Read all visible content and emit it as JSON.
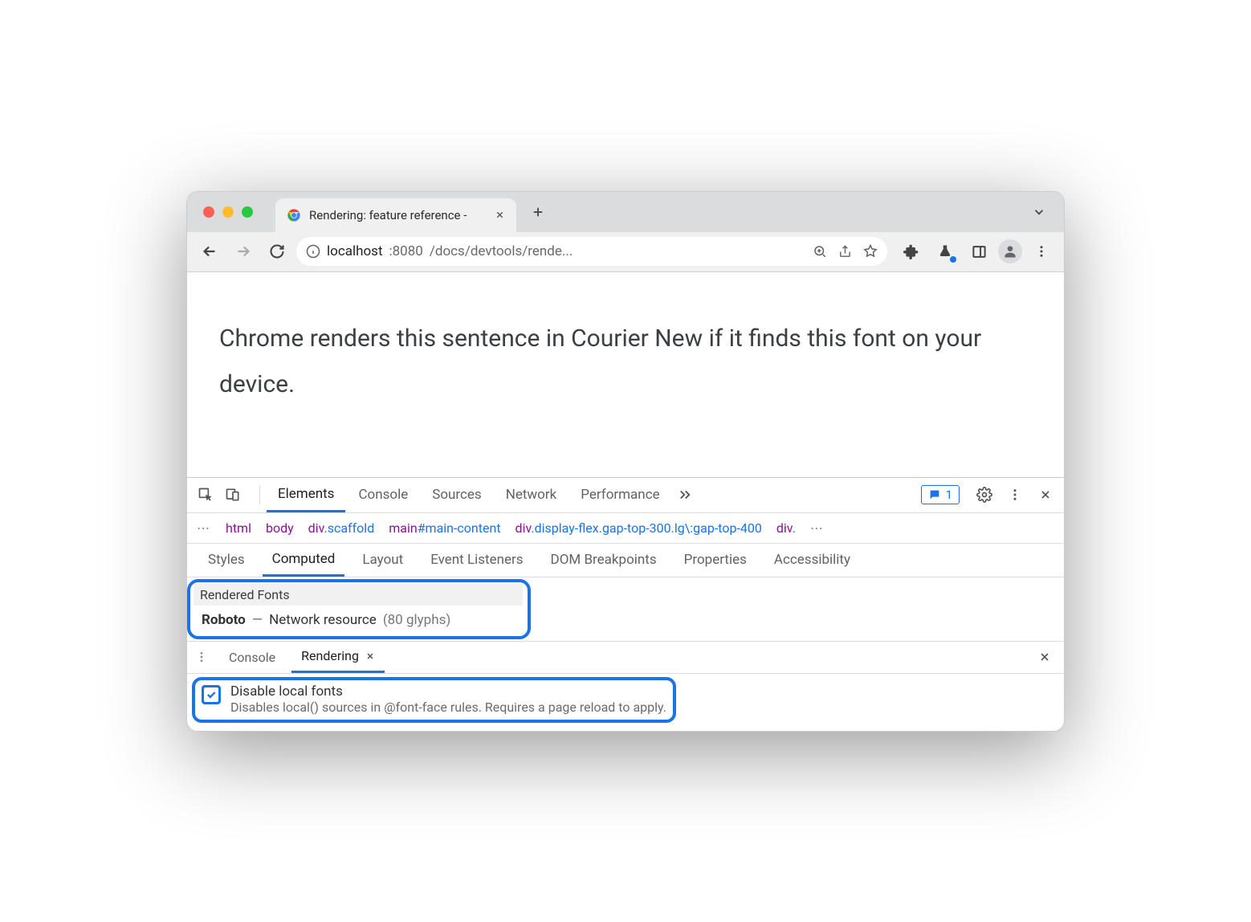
{
  "window": {
    "tab_title": "Rendering: feature reference -"
  },
  "omnibox": {
    "host": "localhost",
    "port": ":8080",
    "path": "/docs/devtools/rende..."
  },
  "page": {
    "sentence": "Chrome renders this sentence in Courier New if it finds this font on your device."
  },
  "devtools": {
    "tabs": [
      "Elements",
      "Console",
      "Sources",
      "Network",
      "Performance"
    ],
    "active_tab": "Elements",
    "issues_count": "1",
    "breadcrumb": [
      {
        "tag": "html"
      },
      {
        "tag": "body"
      },
      {
        "tag": "div",
        "cls": ".scaffold"
      },
      {
        "tag": "main",
        "id": "#main-content"
      },
      {
        "tag": "div",
        "cls": ".display-flex.gap-top-300.lg\\:gap-top-400"
      },
      {
        "tag": "div",
        "cls": "."
      }
    ],
    "subtabs": [
      "Styles",
      "Computed",
      "Layout",
      "Event Listeners",
      "DOM Breakpoints",
      "Properties",
      "Accessibility"
    ],
    "active_subtab": "Computed",
    "rendered_fonts": {
      "title": "Rendered Fonts",
      "font_name": "Roboto",
      "source": "Network resource",
      "glyphs": "(80 glyphs)"
    },
    "drawer": {
      "tabs": [
        "Console",
        "Rendering"
      ],
      "active": "Rendering"
    },
    "option": {
      "title": "Disable local fonts",
      "desc": "Disables local() sources in @font-face rules. Requires a page reload to apply."
    }
  }
}
